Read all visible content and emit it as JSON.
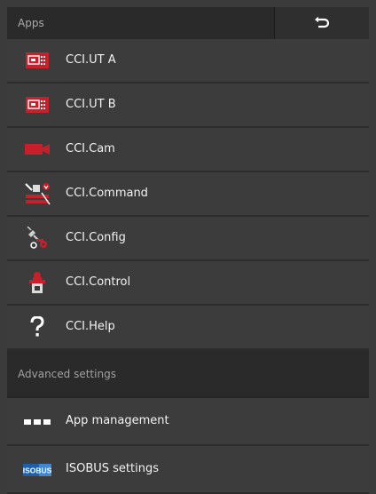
{
  "header": {
    "title": "Apps",
    "back_icon": "return-arrow-icon"
  },
  "apps": [
    {
      "label": "CCI.UT A",
      "icon": "terminal-icon"
    },
    {
      "label": "CCI.UT B",
      "icon": "terminal-icon"
    },
    {
      "label": "CCI.Cam",
      "icon": "camera-icon"
    },
    {
      "label": "CCI.Command",
      "icon": "command-icon"
    },
    {
      "label": "CCI.Config",
      "icon": "config-icon"
    },
    {
      "label": "CCI.Control",
      "icon": "control-icon"
    },
    {
      "label": "CCI.Help",
      "icon": "help-icon"
    }
  ],
  "advanced": {
    "title": "Advanced settings",
    "items": [
      {
        "label": "App management",
        "icon": "app-grid-icon"
      },
      {
        "label": "ISOBUS settings",
        "icon": "isobus-icon",
        "icon_text": "ISOBUS"
      }
    ]
  },
  "colors": {
    "accent_red": "#c8202a",
    "background": "#3b3b3b",
    "header": "#2a2a2a"
  }
}
